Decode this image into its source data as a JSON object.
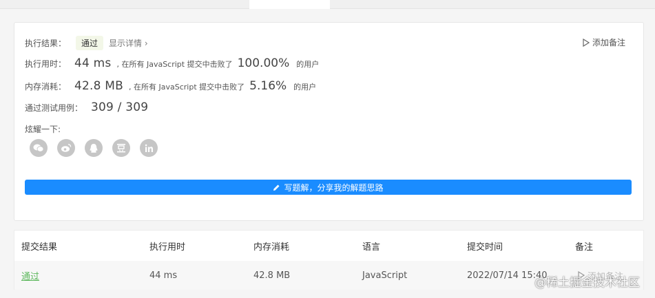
{
  "result": {
    "exec_result_label": "执行结果：",
    "status_badge": "通过",
    "show_details": "显示详情",
    "add_note": "添加备注",
    "time_label": "执行用时：",
    "time_value": "44 ms",
    "time_text": ", 在所有 JavaScript 提交中击败了",
    "time_percent": "100.00%",
    "users_suffix": "的用户",
    "memory_label": "内存消耗：",
    "memory_value": "42.8 MB",
    "memory_text": ", 在所有 JavaScript 提交中击败了",
    "memory_percent": "5.16%",
    "tests_label": "通过测试用例：",
    "tests_value": "309 / 309",
    "share_label": "炫耀一下:",
    "share_icons": [
      "wechat-icon",
      "weibo-icon",
      "qq-icon",
      "douban-icon",
      "linkedin-icon"
    ],
    "write_solution": "写题解，分享我的解题思路"
  },
  "table": {
    "headers": [
      "提交结果",
      "执行用时",
      "内存消耗",
      "语言",
      "提交时间",
      "备注"
    ],
    "rows": [
      {
        "status": "通过",
        "time": "44 ms",
        "memory": "42.8 MB",
        "language": "JavaScript",
        "submitted": "2022/07/14 15:40",
        "note": "添加备注"
      }
    ]
  },
  "watermark": "@稀土掘金技术社区",
  "colors": {
    "accent": "#1a8cff",
    "success": "#5cb85c",
    "badge_bg": "#f3f7e8",
    "icon_gray": "#c6c6c6"
  }
}
